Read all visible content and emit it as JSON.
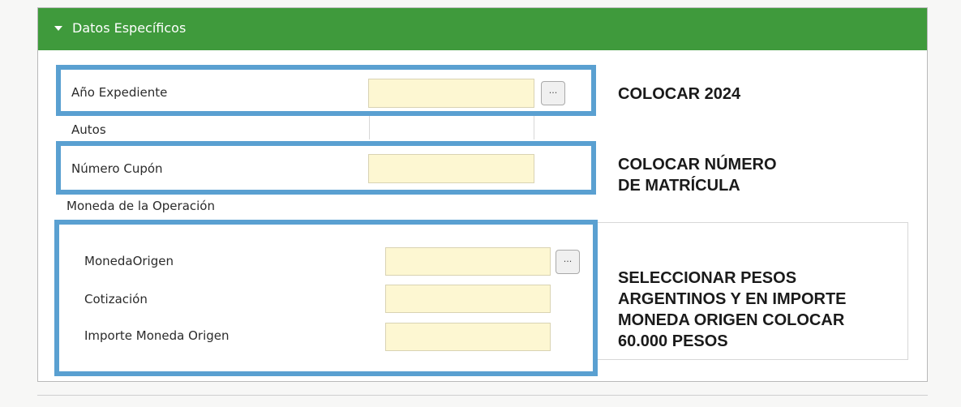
{
  "panel": {
    "title": "Datos Específicos"
  },
  "fields": {
    "anio_expediente": {
      "label": "Año Expediente",
      "value": "",
      "lookup": "..."
    },
    "autos": {
      "label": "Autos"
    },
    "numero_cupon": {
      "label": "Número Cupón",
      "value": ""
    },
    "moneda_operacion": {
      "label": "Moneda de la Operación"
    },
    "moneda_origen": {
      "label": "MonedaOrigen",
      "value": "",
      "lookup": "..."
    },
    "cotizacion": {
      "label": "Cotización",
      "value": ""
    },
    "importe_moneda_origen": {
      "label": "Importe Moneda Origen",
      "value": ""
    }
  },
  "annotations": {
    "note1": "COLOCAR 2024",
    "note2_line1": "COLOCAR NÚMERO",
    "note2_line2": "DE MATRÍCULA",
    "note3_line1": "SELECCIONAR PESOS",
    "note3_line2": "ARGENTINOS Y EN IMPORTE",
    "note3_line3": "MONEDA ORIGEN COLOCAR",
    "note3_line4": "60.000 PESOS"
  },
  "colors": {
    "header": "#3f9a3c",
    "highlight": "#5aa0d1",
    "input_bg": "#fdf7d2"
  }
}
